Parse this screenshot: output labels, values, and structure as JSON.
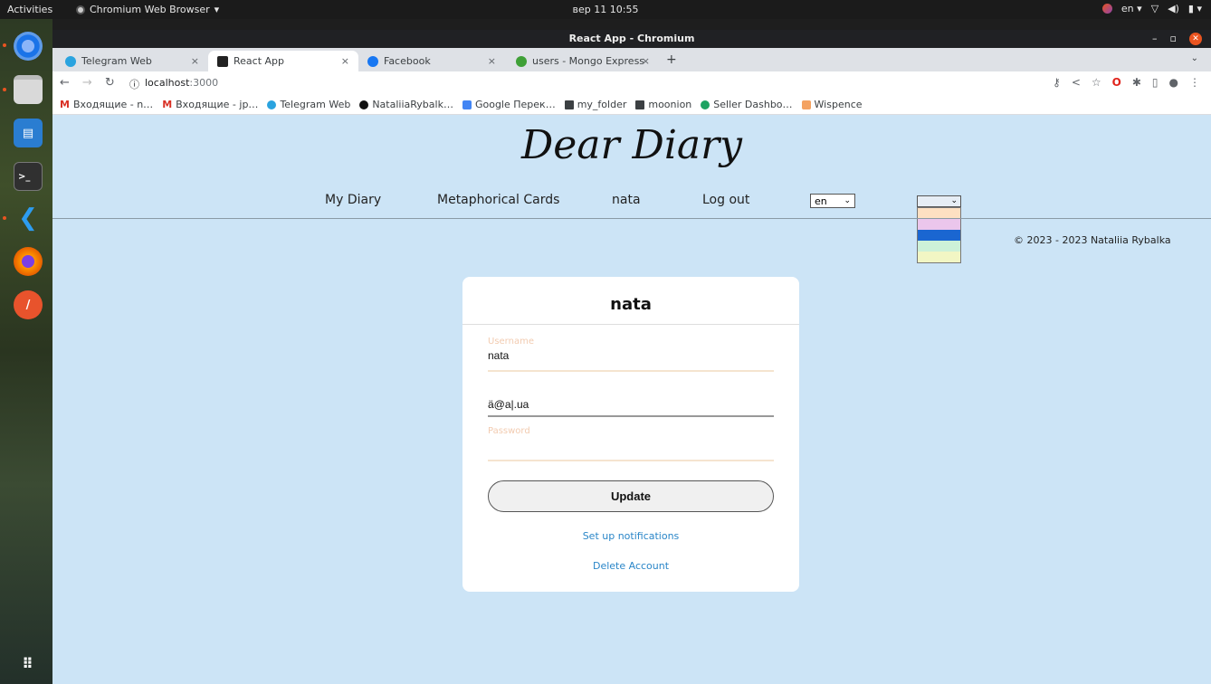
{
  "topbar": {
    "activities": "Activities",
    "app_name": "Chromium Web Browser",
    "clock": "вер 11  10:55",
    "lang": "en"
  },
  "dock": {
    "icons": [
      "chromium-icon",
      "files-icon",
      "libreoffice-writer-icon",
      "terminal-icon",
      "vscode-icon",
      "firefox-icon",
      "gimp-icon",
      "app-grid-icon"
    ]
  },
  "browser": {
    "window_title": "React App - Chromium",
    "tabs": [
      {
        "label": "Telegram Web",
        "color": "#2aa3df"
      },
      {
        "label": "React App",
        "color": "#222222"
      },
      {
        "label": "Facebook",
        "color": "#1877f2"
      },
      {
        "label": "users - Mongo Express",
        "color": "#3fa037"
      }
    ],
    "new_tab": "+",
    "url_host": "localhost",
    "url_port": ":3000",
    "bookmarks": [
      {
        "label": "Входящие - n…",
        "color": "#d93025"
      },
      {
        "label": "Входящие - jp…",
        "color": "#d93025"
      },
      {
        "label": "Telegram Web",
        "color": "#2aa3df"
      },
      {
        "label": "NataliiaRybalk…",
        "color": "#111111"
      },
      {
        "label": "Google Перек…",
        "color": "#4285f4"
      },
      {
        "label": "my_folder",
        "color": "#3c4043"
      },
      {
        "label": "moonion",
        "color": "#3c4043"
      },
      {
        "label": "Seller Dashbo…",
        "color": "#1ea362"
      },
      {
        "label": "Wispence",
        "color": "#f4a261"
      }
    ]
  },
  "page": {
    "brand": "Dear Diary",
    "nav": {
      "my_diary": "My Diary",
      "cards": "Metaphorical Cards",
      "user": "nata",
      "logout": "Log out"
    },
    "language_value": "en",
    "color_swatches": [
      "#fde0c2",
      "#ebc6ec",
      "#1a66d1",
      "#cdf1d8",
      "#f2f6c4"
    ],
    "copyright": "© 2023 - 2023 Nataliia Rybalka",
    "card": {
      "title": "nata",
      "username_label": "Username",
      "username_value": "nata",
      "email_value": "ä@a|.ua",
      "password_label": "Password",
      "password_value": "",
      "update": "Update",
      "notifications": "Set up notifications",
      "delete": "Delete Account"
    }
  }
}
